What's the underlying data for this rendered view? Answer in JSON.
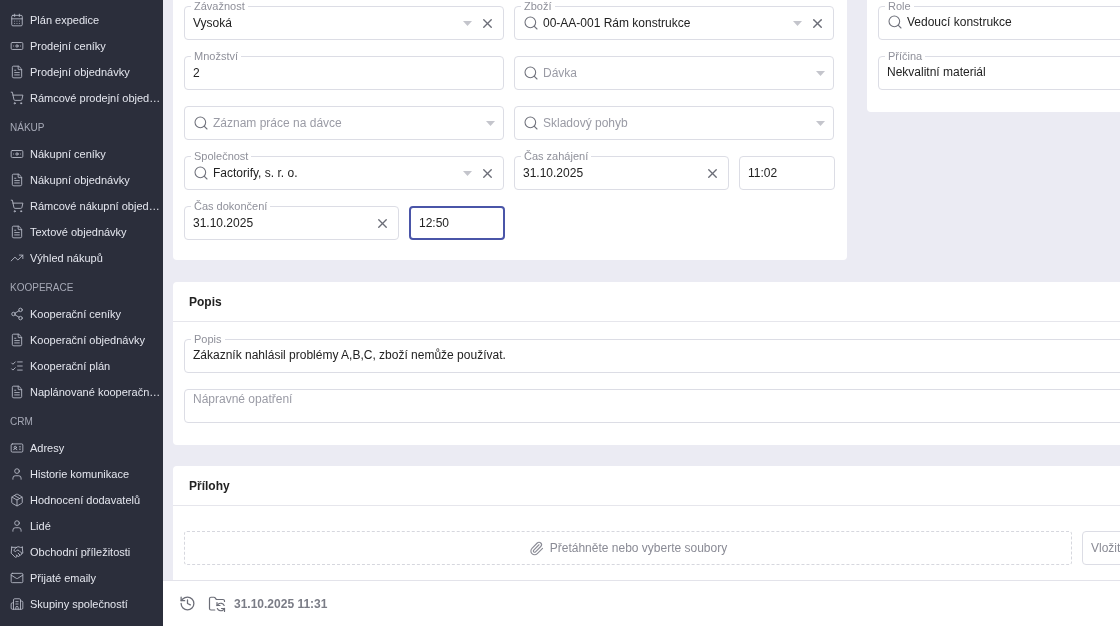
{
  "sidebar": {
    "sections": [
      {
        "items": [
          {
            "label": "Plán expedice",
            "kind": "calendar"
          },
          {
            "label": "Prodejní ceníky",
            "kind": "pricelist"
          },
          {
            "label": "Prodejní objednávky",
            "kind": "order"
          },
          {
            "label": "Rámcové prodejní objed…",
            "kind": "cart"
          }
        ]
      },
      {
        "heading": "NÁKUP",
        "items": [
          {
            "label": "Nákupní ceníky",
            "kind": "pricelist"
          },
          {
            "label": "Nákupní objednávky",
            "kind": "order"
          },
          {
            "label": "Rámcové nákupní objed…",
            "kind": "cart"
          },
          {
            "label": "Textové objednávky",
            "kind": "order"
          },
          {
            "label": "Výhled nákupů",
            "kind": "chart"
          }
        ]
      },
      {
        "heading": "KOOPERACE",
        "items": [
          {
            "label": "Kooperační ceníky",
            "kind": "share"
          },
          {
            "label": "Kooperační objednávky",
            "kind": "order"
          },
          {
            "label": "Kooperační plán",
            "kind": "list"
          },
          {
            "label": "Naplánované kooperačn…",
            "kind": "order"
          }
        ]
      },
      {
        "heading": "CRM",
        "items": [
          {
            "label": "Adresy",
            "kind": "card"
          },
          {
            "label": "Historie komunikace",
            "kind": "person"
          },
          {
            "label": "Hodnocení dodavatelů",
            "kind": "box"
          },
          {
            "label": "Lidé",
            "kind": "person"
          },
          {
            "label": "Obchodní příležitosti",
            "kind": "handshake"
          },
          {
            "label": "Přijaté emaily",
            "kind": "mail"
          },
          {
            "label": "Skupiny společností",
            "kind": "buildings"
          }
        ]
      }
    ]
  },
  "details": {
    "fields": [
      {
        "kind": "select",
        "label": "Závažnost",
        "value": "Vysoká",
        "search": false,
        "clear": true,
        "dropdown": true,
        "focused": false
      },
      {
        "kind": "select",
        "label": "Zboží",
        "value": "00-AA-001 Rám konstrukce",
        "search": true,
        "clear": true,
        "dropdown": true,
        "focused": false
      },
      {
        "kind": "select",
        "label": "Množství",
        "value": "2",
        "search": false,
        "clear": false,
        "dropdown": false,
        "focused": false
      },
      {
        "kind": "select",
        "placeholder": "Dávka",
        "search": true,
        "clear": false,
        "dropdown": true,
        "focused": false
      },
      {
        "kind": "select",
        "placeholder": "Záznam práce na dávce",
        "search": true,
        "clear": false,
        "dropdown": true,
        "focused": false
      },
      {
        "kind": "select",
        "placeholder": "Skladový pohyb",
        "search": true,
        "clear": false,
        "dropdown": true,
        "focused": false
      },
      {
        "kind": "select",
        "label": "Společnost",
        "value": "Factorify, s. r. o.",
        "search": true,
        "clear": true,
        "dropdown": true,
        "focused": false
      },
      {
        "kind": "date",
        "label": "Čas zahájení",
        "value": "31.10.2025",
        "search": false,
        "clear": true,
        "dropdown": false,
        "focused": false
      },
      {
        "kind": "time",
        "value": "11:02",
        "search": false,
        "clear": false,
        "dropdown": false,
        "focused": false
      },
      {
        "kind": "date",
        "label": "Čas dokončení",
        "value": "31.10.2025",
        "search": false,
        "clear": true,
        "dropdown": false,
        "focused": false
      },
      {
        "kind": "time",
        "value": "12:50",
        "search": false,
        "clear": false,
        "dropdown": false,
        "focused": true
      }
    ]
  },
  "side_card": {
    "fields": [
      {
        "label": "Role",
        "value": "Vedoucí konstrukce",
        "search": true,
        "focused": false
      },
      {
        "label": "Příčina",
        "value": "Nekvalitní materiál",
        "search": false,
        "focused": false
      }
    ]
  },
  "description": {
    "title": "Popis",
    "fields": [
      {
        "label": "Popis",
        "value": "Zákazník nahlásil problémy A,B,C, zboží nemůže používat.",
        "focused": false
      },
      {
        "placeholder": "Nápravné opatření",
        "focused": false
      }
    ]
  },
  "attachments": {
    "title": "Přílohy",
    "dropzone": "Přetáhněte nebo vyberte soubory",
    "paste_button": "Vložit"
  },
  "footer": {
    "timestamp": "31.10.2025 11:31"
  }
}
